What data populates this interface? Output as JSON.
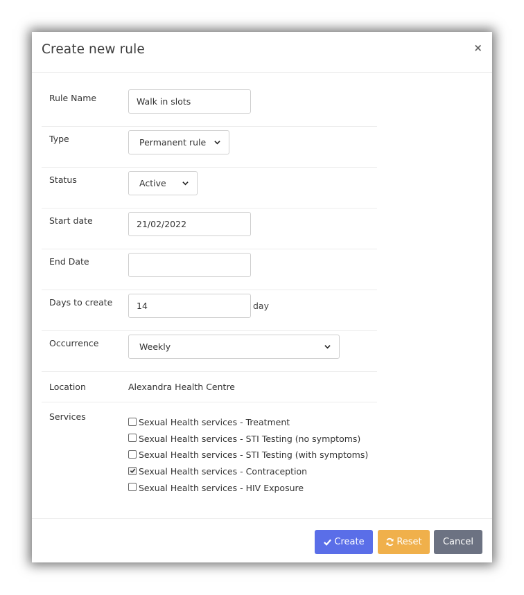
{
  "modal": {
    "title": "Create new rule",
    "close_glyph": "×"
  },
  "form": {
    "rule_name": {
      "label": "Rule Name",
      "value": "Walk in slots"
    },
    "type": {
      "label": "Type",
      "selected": "Permanent rule"
    },
    "status": {
      "label": "Status",
      "selected": "Active"
    },
    "start_date": {
      "label": "Start date",
      "value": "21/02/2022"
    },
    "end_date": {
      "label": "End Date",
      "value": ""
    },
    "days_to_create": {
      "label": "Days to create",
      "value": "14",
      "suffix": "day"
    },
    "occurrence": {
      "label": "Occurrence",
      "selected": "Weekly"
    },
    "location": {
      "label": "Location",
      "value": "Alexandra Health Centre"
    },
    "services": {
      "label": "Services",
      "items": [
        {
          "label": "Sexual Health services - Treatment",
          "checked": false
        },
        {
          "label": "Sexual Health services - STI Testing (no symptoms)",
          "checked": false
        },
        {
          "label": "Sexual Health services - STI Testing (with symptoms)",
          "checked": false
        },
        {
          "label": "Sexual Health services - Contraception",
          "checked": true
        },
        {
          "label": "Sexual Health services - HIV Exposure",
          "checked": false
        }
      ]
    }
  },
  "footer": {
    "create_label": "Create",
    "reset_label": "Reset",
    "cancel_label": "Cancel"
  },
  "icons": {
    "create": "check-icon",
    "reset": "refresh-icon",
    "select": "chevron-down-icon"
  },
  "colors": {
    "create": "#5a6ee8",
    "reset": "#f0b04b",
    "cancel": "#6c7282"
  }
}
